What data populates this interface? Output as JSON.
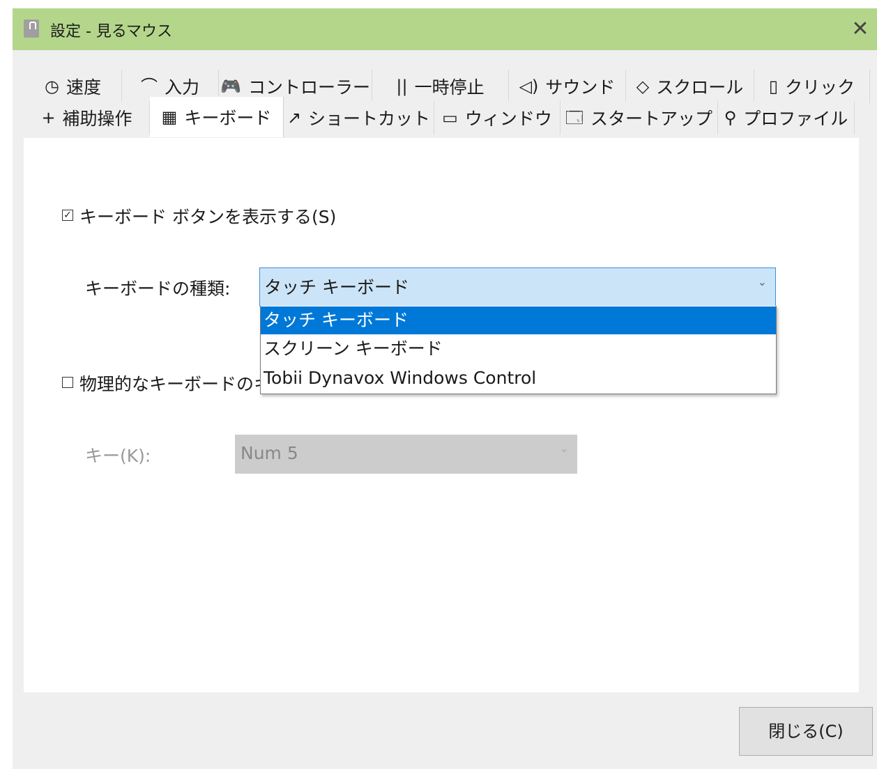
{
  "window": {
    "title": "設定 - 見るマウス",
    "close_glyph": "✕"
  },
  "tabs_row1": [
    {
      "label": "速度",
      "icon": "◷"
    },
    {
      "label": "入力",
      "icon": "⌒"
    },
    {
      "label": "コントローラー",
      "icon": "🎮"
    },
    {
      "label": "一時停止",
      "icon": "||"
    },
    {
      "label": "サウンド",
      "icon": "◁)"
    },
    {
      "label": "スクロール",
      "icon": "◇"
    },
    {
      "label": "クリック",
      "icon": "▯"
    }
  ],
  "tabs_row2": [
    {
      "label": "補助操作",
      "icon": "+"
    },
    {
      "label": "キーボード",
      "icon": "▦",
      "active": true
    },
    {
      "label": "ショートカット",
      "icon": "↗"
    },
    {
      "label": "ウィンドウ",
      "icon": "▭"
    },
    {
      "label": "スタートアップ",
      "icon": "🗔"
    },
    {
      "label": "プロファイル",
      "icon": "⚲"
    }
  ],
  "keyboard": {
    "show_button_label": "キーボード ボタンを表示する(S)",
    "show_button_checked": true,
    "type_label": "キーボードの種類:",
    "type_value": "タッチ キーボード",
    "type_options": [
      "タッチ キーボード",
      "スクリーン キーボード",
      "Tobii Dynavox Windows Control"
    ],
    "physical_label": "物理的なキーボードのキ",
    "physical_checked": false,
    "key_label": "キー(K):",
    "key_value": "Num 5"
  },
  "footer": {
    "close_label": "閉じる(C)"
  },
  "colors": {
    "titlebar": "#b4d68b",
    "selection": "#0078d7",
    "combo_focus": "#cce4f7"
  }
}
